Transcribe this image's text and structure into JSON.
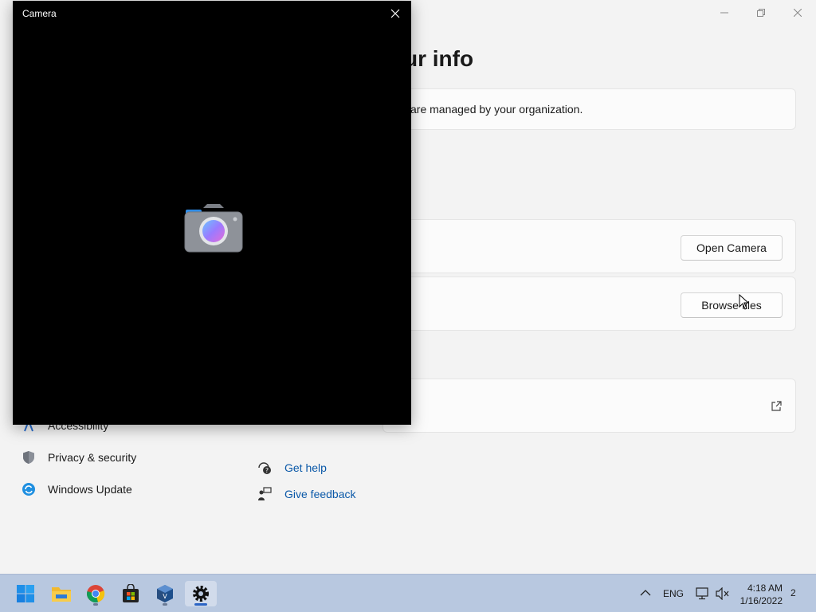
{
  "settings": {
    "page_title": "ur info",
    "managed_notice": "are managed by your organization.",
    "open_camera_label": "Open Camera",
    "browse_files_label": "Browse files",
    "sidebar": [
      {
        "label": "Accessibility",
        "icon": "accessibility-icon"
      },
      {
        "label": "Privacy & security",
        "icon": "shield-icon"
      },
      {
        "label": "Windows Update",
        "icon": "windows-update-icon"
      }
    ],
    "help_links": [
      {
        "label": "Get help",
        "icon": "help-icon"
      },
      {
        "label": "Give feedback",
        "icon": "feedback-icon"
      }
    ]
  },
  "camera": {
    "title": "Camera"
  },
  "taskbar": {
    "apps": [
      "start-icon",
      "file-explorer-icon",
      "chrome-icon",
      "store-icon",
      "virtualbox-icon",
      "settings-icon"
    ],
    "language": "ENG",
    "time": "4:18 AM",
    "date": "1/16/2022",
    "notification_count": "2"
  },
  "colors": {
    "accent": "#0a58a8",
    "taskbar": "#b8c8e0",
    "background": "#f3f3f3"
  }
}
